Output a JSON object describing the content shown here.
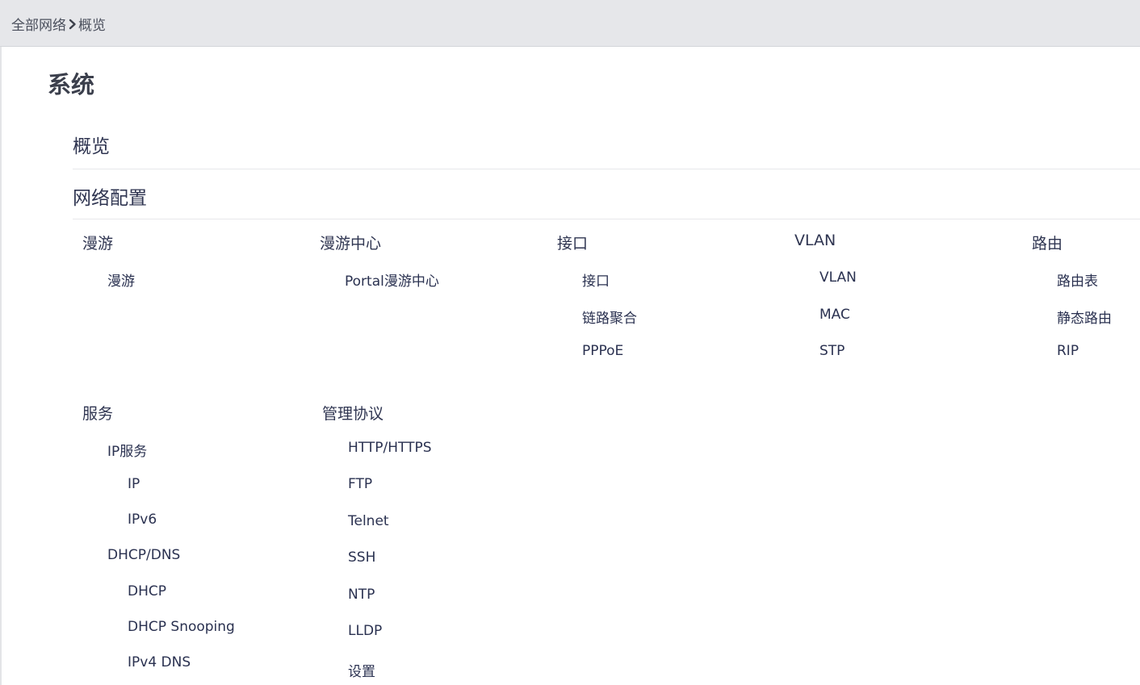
{
  "breadcrumb": {
    "root": "全部网络",
    "current": "概览"
  },
  "page_title": "系统",
  "sections": {
    "overview": "概览",
    "network_config": "网络配置"
  },
  "categories": {
    "roaming": {
      "title": "漫游",
      "items": [
        "漫游"
      ]
    },
    "roaming_center": {
      "title": "漫游中心",
      "items": [
        "Portal漫游中心"
      ]
    },
    "interface": {
      "title": "接口",
      "items": [
        "接口",
        "链路聚合",
        "PPPoE"
      ]
    },
    "vlan": {
      "title": "VLAN",
      "items": [
        "VLAN",
        "MAC",
        "STP"
      ]
    },
    "routing": {
      "title": "路由",
      "items": [
        "路由表",
        "静态路由",
        "RIP"
      ]
    },
    "services": {
      "title": "服务",
      "groups": [
        {
          "label": "IP服务",
          "items": [
            "IP",
            "IPv6"
          ]
        },
        {
          "label": "DHCP/DNS",
          "items": [
            "DHCP",
            "DHCP Snooping",
            "IPv4 DNS"
          ]
        }
      ]
    },
    "management": {
      "title": "管理协议",
      "items": [
        "HTTP/HTTPS",
        "FTP",
        "Telnet",
        "SSH",
        "NTP",
        "LLDP",
        "设置"
      ]
    }
  },
  "colors": {
    "topbar_bg": "#e6e7ea",
    "text_primary": "#2f3551",
    "divider": "#e7e8eb"
  }
}
